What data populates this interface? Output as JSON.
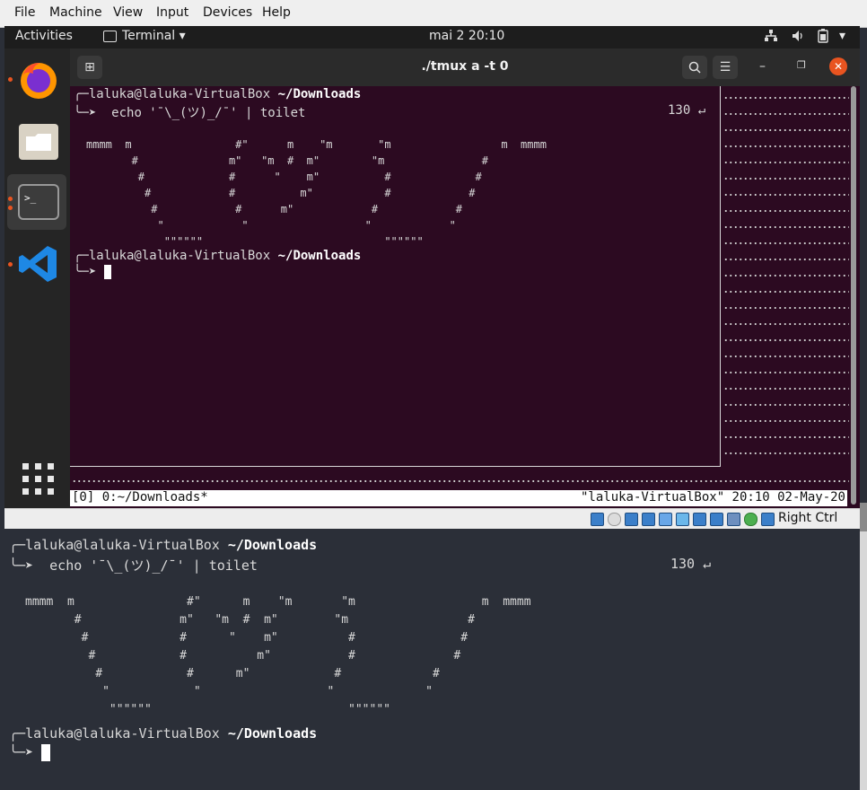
{
  "vbox_menu": [
    "File",
    "Machine",
    "View",
    "Input",
    "Devices",
    "Help"
  ],
  "gnome": {
    "activities": "Activities",
    "app_name": "Terminal",
    "clock": "mai 2  20:10"
  },
  "terminal_window": {
    "title": "./tmux a -t 0"
  },
  "vm_shell": {
    "prompt1_user": "laluka@laluka-VirtualBox",
    "prompt1_dir": "~/Downloads",
    "command": "echo '¯\\_(ツ)_/¯' | toilet",
    "exit_code": "130 ↵",
    "art": [
      "mmmm  m                #\"      m    \"m       \"m                 m  mmmm",
      "       #              m\"   \"m  #  m\"        \"m               #",
      "        #             #      \"    m\"          #             #",
      "         #            #          m\"           #            #",
      "          #            #      m\"            #            #",
      "           \"            \"                  \"            \"",
      "            \"\"\"\"\"\"                            \"\"\"\"\"\""
    ],
    "prompt2_user": "laluka@laluka-VirtualBox",
    "prompt2_dir": "~/Downloads"
  },
  "tmux_status": {
    "left": "[0] 0:~/Downloads*",
    "right": "\"laluka-VirtualBox\" 20:10 02-May-20"
  },
  "vb_status": {
    "host_key": "Right Ctrl"
  },
  "host_shell": {
    "prompt1_user": "laluka@laluka-VirtualBox",
    "prompt1_dir": "~/Downloads",
    "command": "echo '¯\\_(ツ)_/¯' | toilet",
    "exit_code": "130 ↵",
    "art": [
      "mmmm  m                #\"      m    \"m       \"m                  m  mmmm",
      "       #              m\"   \"m  #  m\"        \"m                 #",
      "        #             #      \"    m\"          #               #",
      "         #            #          m\"           #              #",
      "          #            #      m\"            #             #",
      "           \"            \"                  \"             \"",
      "            \"\"\"\"\"\"                            \"\"\"\"\"\""
    ],
    "prompt2_user": "laluka@laluka-VirtualBox",
    "prompt2_dir": "~/Downloads"
  },
  "colors": {
    "terminal_bg": "#2c0a21",
    "host_bg": "#2b2f38",
    "accent": "#e95420"
  }
}
